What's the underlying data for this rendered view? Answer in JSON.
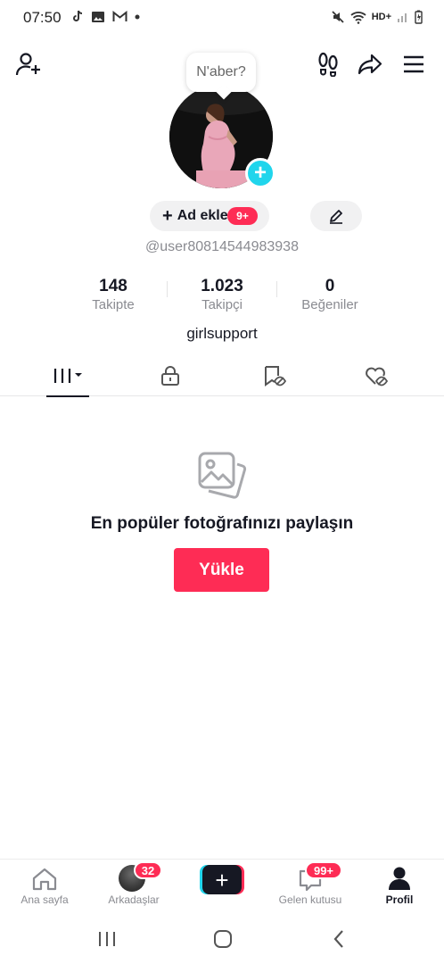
{
  "status_bar": {
    "time": "07:50",
    "network": "HD+",
    "left_icons": [
      "tiktok-icon",
      "gallery-icon",
      "gmail-icon",
      "dot-icon"
    ],
    "right_icons": [
      "mute-icon",
      "wifi-icon",
      "signal-icon",
      "battery-icon"
    ]
  },
  "header": {
    "left_icon": "add-user-icon",
    "right_icons": [
      "footprints-icon",
      "share-icon",
      "menu-icon"
    ]
  },
  "profile": {
    "bubble_text": "N'aber?",
    "add_name_label": "Ad ekle",
    "add_name_badge": "9+",
    "handle": "@user80814544983938",
    "bio": "girlsupport"
  },
  "stats": [
    {
      "value": "148",
      "label": "Takipte"
    },
    {
      "value": "1.023",
      "label": "Takipçi"
    },
    {
      "value": "0",
      "label": "Beğeniler"
    }
  ],
  "tabs": [
    "videos-grid-icon",
    "lock-icon",
    "bookmark-eye-icon",
    "heart-eye-icon"
  ],
  "empty_state": {
    "title": "En popüler fotoğrafınızı paylaşın",
    "button": "Yükle"
  },
  "bottom_nav": {
    "home": "Ana sayfa",
    "friends": "Arkadaşlar",
    "friends_badge": "32",
    "inbox": "Gelen kutusu",
    "inbox_badge": "99+",
    "profile": "Profil"
  },
  "colors": {
    "accent": "#fe2c55",
    "cyan": "#20d5ec",
    "text": "#161823",
    "muted": "#8a8b91"
  }
}
